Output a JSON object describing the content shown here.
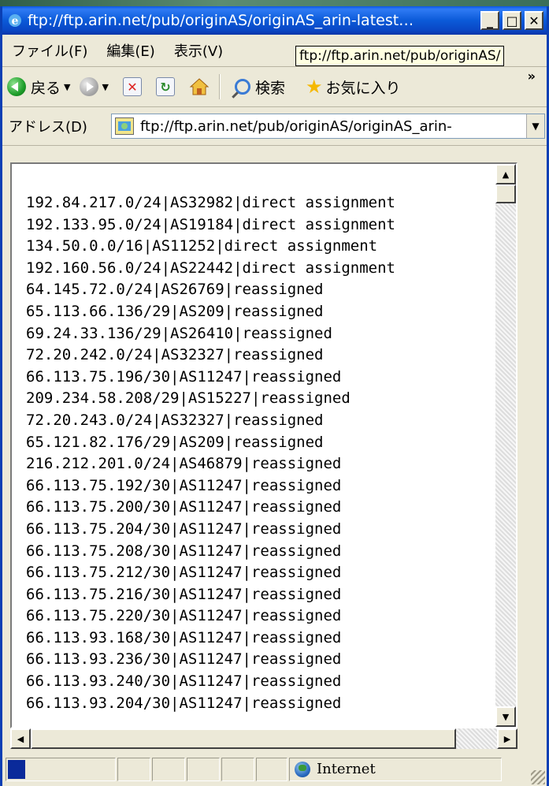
{
  "window": {
    "title": "ftp://ftp.arin.net/pub/originAS/originAS_arin-latest…",
    "controls": {
      "minimize": "_",
      "maximize": "□",
      "close": "✕"
    }
  },
  "menu": {
    "items": [
      "ファイル(F)",
      "編集(E)",
      "表示(V)"
    ],
    "tooltip": "ftp://ftp.arin.net/pub/originAS/"
  },
  "toolbar": {
    "back_label": "戻る",
    "search_label": "検索",
    "favorites_label": "お気に入り",
    "overflow": "»",
    "icons": [
      "back-icon",
      "forward-icon",
      "stop-icon",
      "refresh-icon",
      "home-icon",
      "search-icon",
      "favorites-icon"
    ]
  },
  "address": {
    "label": "アドレス(D)",
    "value": "ftp://ftp.arin.net/pub/originAS/originAS_arin-"
  },
  "content": {
    "lines": [
      "192.84.217.0/24|AS32982|direct assignment",
      "192.133.95.0/24|AS19184|direct assignment",
      "134.50.0.0/16|AS11252|direct assignment",
      "192.160.56.0/24|AS22442|direct assignment",
      "64.145.72.0/24|AS26769|reassigned",
      "65.113.66.136/29|AS209|reassigned",
      "69.24.33.136/29|AS26410|reassigned",
      "72.20.242.0/24|AS32327|reassigned",
      "66.113.75.196/30|AS11247|reassigned",
      "209.234.58.208/29|AS15227|reassigned",
      "72.20.243.0/24|AS32327|reassigned",
      "65.121.82.176/29|AS209|reassigned",
      "216.212.201.0/24|AS46879|reassigned",
      "66.113.75.192/30|AS11247|reassigned",
      "66.113.75.200/30|AS11247|reassigned",
      "66.113.75.204/30|AS11247|reassigned",
      "66.113.75.208/30|AS11247|reassigned",
      "66.113.75.212/30|AS11247|reassigned",
      "66.113.75.216/30|AS11247|reassigned",
      "66.113.75.220/30|AS11247|reassigned",
      "66.113.93.168/30|AS11247|reassigned",
      "66.113.93.236/30|AS11247|reassigned",
      "66.113.93.240/30|AS11247|reassigned",
      "66.113.93.204/30|AS11247|reassigned"
    ]
  },
  "status": {
    "zone": "Internet"
  }
}
